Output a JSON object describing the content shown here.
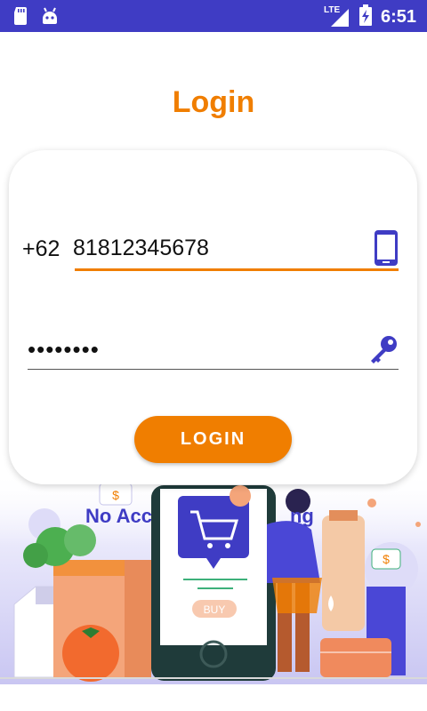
{
  "colors": {
    "status_bar": "#3f3cc4",
    "accent_orange": "#f07e00",
    "brand_purple": "#3f3cc4",
    "title_orange": "#f07e00"
  },
  "status_bar": {
    "time": "6:51",
    "network_label": "LTE",
    "icons": [
      "sd-card-icon",
      "android-icon",
      "signal-icon",
      "battery-charging-icon"
    ]
  },
  "page": {
    "title": "Login"
  },
  "form": {
    "country_code": "+62",
    "phone_value": "81812345678",
    "password_value": "••••••••",
    "phone_icon": "smartphone-icon",
    "password_icon": "key-icon",
    "login_label": "LOGIN"
  },
  "background": {
    "partial_text": "No Acc",
    "partial_text_right": "ng",
    "buy_label": "BUY"
  }
}
